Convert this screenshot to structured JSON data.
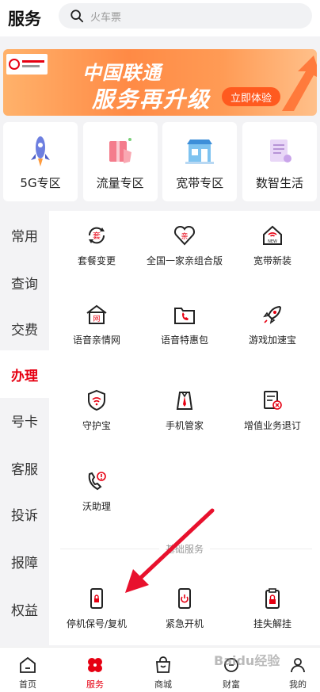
{
  "header": {
    "title": "服务",
    "search_placeholder": "火车票"
  },
  "banner": {
    "logo_text": "中国联通",
    "slogan": "服务再升级",
    "cta_label": "立即体验",
    "accent_color": "#ff5a1f"
  },
  "zones": [
    {
      "label": "5G专区",
      "icon": "rocket-icon"
    },
    {
      "label": "流量专区",
      "icon": "gift-box-icon"
    },
    {
      "label": "宽带专区",
      "icon": "store-icon"
    },
    {
      "label": "数智生活",
      "icon": "document-icon"
    }
  ],
  "sidebar": {
    "items": [
      {
        "label": "常用"
      },
      {
        "label": "查询"
      },
      {
        "label": "交费"
      },
      {
        "label": "办理"
      },
      {
        "label": "号卡"
      },
      {
        "label": "客服"
      },
      {
        "label": "投诉"
      },
      {
        "label": "报障"
      },
      {
        "label": "权益"
      }
    ],
    "active_index": 3,
    "active_color": "#e60012"
  },
  "services": [
    {
      "label": "套餐变更",
      "icon": "package-change-icon"
    },
    {
      "label": "全国一家亲组合版",
      "icon": "family-heart-icon"
    },
    {
      "label": "宽带新装",
      "icon": "broadband-new-icon"
    },
    {
      "label": "语音亲情网",
      "icon": "home-network-icon"
    },
    {
      "label": "语音特惠包",
      "icon": "phone-folder-icon"
    },
    {
      "label": "游戏加速宝",
      "icon": "rocket-icon"
    },
    {
      "label": "守护宝",
      "icon": "shield-icon"
    },
    {
      "label": "手机管家",
      "icon": "butler-icon"
    },
    {
      "label": "增值业务退订",
      "icon": "unsubscribe-icon"
    },
    {
      "label": "沃助理",
      "icon": "phone-alert-icon"
    }
  ],
  "basic_section": {
    "title": "基础服务",
    "items": [
      {
        "label": "停机保号/复机",
        "icon": "phone-lock-icon"
      },
      {
        "label": "紧急开机",
        "icon": "phone-power-icon"
      },
      {
        "label": "挂失解挂",
        "icon": "lock-clipboard-icon"
      }
    ]
  },
  "bottom_nav": {
    "items": [
      {
        "label": "首页",
        "icon": "home-icon"
      },
      {
        "label": "服务",
        "icon": "flower-icon"
      },
      {
        "label": "商城",
        "icon": "bag-icon"
      },
      {
        "label": "财富",
        "icon": "wealth-icon"
      },
      {
        "label": "我的",
        "icon": "user-icon"
      }
    ],
    "active_index": 1
  },
  "watermark": "Baidu经验"
}
